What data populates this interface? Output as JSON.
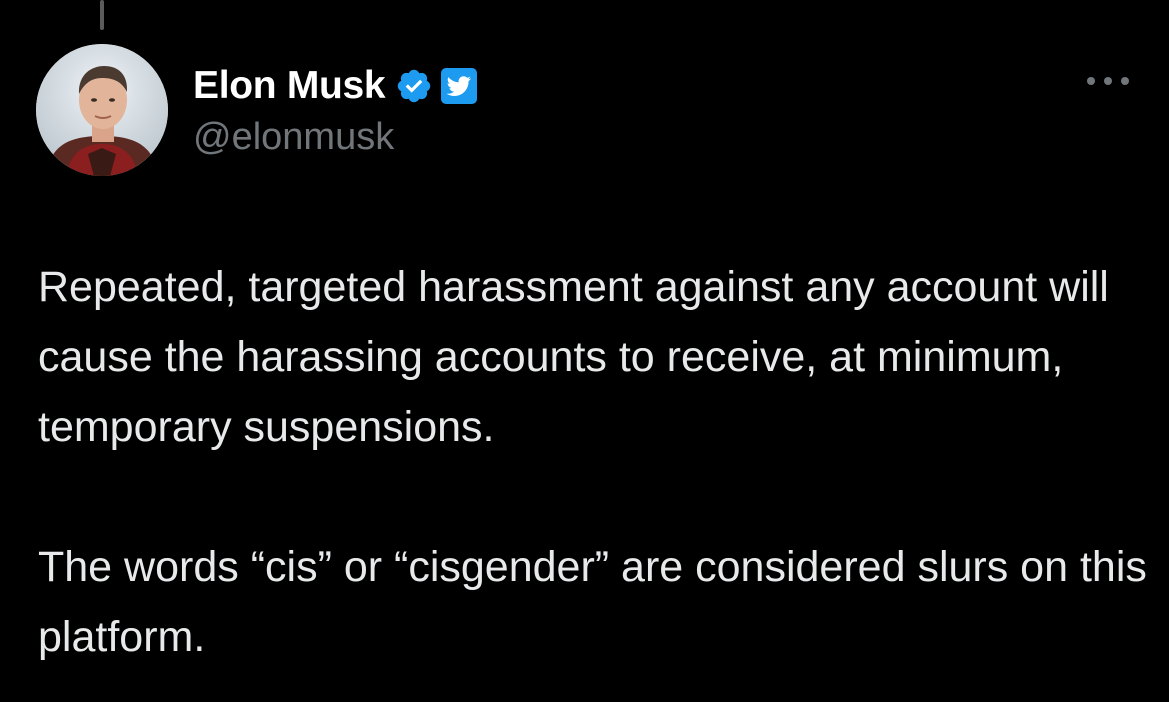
{
  "author": {
    "display_name": "Elon Musk",
    "handle": "@elonmusk",
    "verified": true,
    "avatar_icon": "profile-photo"
  },
  "tweet": {
    "paragraphs": [
      "Repeated, targeted harassment against any account will cause the harassing accounts to receive, at minimum, temporary suspensions.",
      "The words “cis” or “cisgender” are considered slurs on this platform."
    ]
  },
  "colors": {
    "background": "#000000",
    "text": "#e7e9ea",
    "secondary_text": "#71767b",
    "accent": "#1d9bf0"
  },
  "icons": {
    "verified": "verified-check-icon",
    "brand": "twitter-bird-icon",
    "more": "more-options-icon"
  }
}
